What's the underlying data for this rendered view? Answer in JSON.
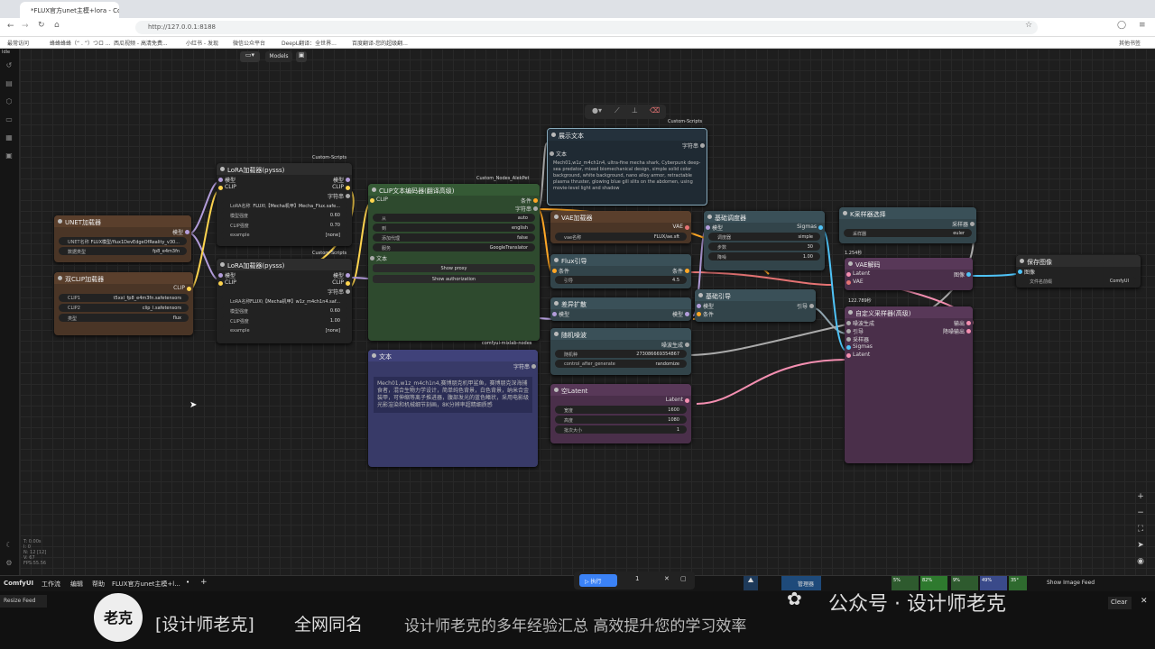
{
  "browser": {
    "tab_title": "*FLUX官方unet主模+lora - Co",
    "url": "http://127.0.0.1:8188",
    "bookmarks": [
      "最常访问",
      "蜂蜂蜂蜂（“ . ”）つロ ...",
      "西瓜视频 - 高清免费...",
      "小红书 - 发现",
      "微信公众平台",
      "DeepL翻译：全世界...",
      "百度翻译-您的超级翻..."
    ],
    "bookmarks_right": "其他书签"
  },
  "app": {
    "status_idle": "Idle",
    "models_label": "Models",
    "menu": [
      "ComfyUI",
      "工作流",
      "编辑",
      "帮助"
    ],
    "workflow_tab": "FLUX官方unet主模+l...",
    "queue_label": "执行",
    "queue_count": "1",
    "manager_label": "管理器",
    "show_image_feed": "Show Image Feed",
    "clear_label": "Clear",
    "resize_feed": "Resize Feed",
    "stats": {
      "cpu": "5%",
      "ram": "82%",
      "gpu": "9%",
      "vram": "49%",
      "temp": "35°"
    },
    "fps_lines": [
      "T: 0.00s",
      "I: 0",
      "N: 12 [12]",
      "V: 67",
      "FPS:55.56"
    ]
  },
  "nodes": {
    "unet": {
      "title": "UNET加载器",
      "out": "模型",
      "w": [
        [
          "UNET名称",
          "FLUX模型/flux1DevEdgeOfReality_v30..."
        ],
        [
          "数据类型",
          "fp8_e4m3fn"
        ]
      ]
    },
    "dualclip": {
      "title": "双CLIP加载器",
      "out": "CLIP",
      "w": [
        [
          "CLIP1",
          "t5xxl_fp8_e4m3fn.safetensors"
        ],
        [
          "CLIP2",
          "clip_l.safetensors"
        ],
        [
          "类型",
          "flux"
        ]
      ]
    },
    "lora1": {
      "title": "LoRA加载器(pysss)",
      "tag": "Custom-Scripts",
      "in": [
        "模型",
        "CLIP"
      ],
      "out": [
        "模型",
        "CLIP",
        "字符串"
      ],
      "w": [
        [
          "LoRA名称",
          "FLUX\\【Mecha机甲】Mecha_Flux.safe..."
        ],
        [
          "模型强度",
          "0.60"
        ],
        [
          "CLIP强度",
          "0.70"
        ],
        [
          "example",
          "[none]"
        ]
      ]
    },
    "lora2": {
      "title": "LoRA加载器(pysss)",
      "tag": "Custom-Scripts",
      "in": [
        "模型",
        "CLIP"
      ],
      "out": [
        "模型",
        "CLIP",
        "字符串"
      ],
      "w": [
        [
          "LoRA名称",
          "FLUX\\【Mecha机甲】w1z_m4ch1n4.saf..."
        ],
        [
          "模型强度",
          "0.60"
        ],
        [
          "CLIP强度",
          "1.00"
        ],
        [
          "example",
          "[none]"
        ]
      ]
    },
    "clipenc": {
      "title": "CLIP文本编码器(翻译高级)",
      "tag": "Custom_Nodes_AlekPet",
      "in": [
        "CLIP"
      ],
      "out": [
        "条件",
        "字符串"
      ],
      "w": [
        [
          "从",
          "auto"
        ],
        [
          "到",
          "english"
        ],
        [
          "添加代理",
          "false"
        ],
        [
          "服务",
          "GoogleTranslator"
        ]
      ],
      "text_label": "文本",
      "buttons": [
        "Show proxy",
        "Show authorization"
      ]
    },
    "textnode": {
      "title": "文本",
      "tag": "comfyui-mixlab-nodes",
      "out": "字符串",
      "text": "Mech01,w1z_m4ch1n4,赛博朋克机甲鲨鱼，赛博朋克深海捕食者，混合生物力学设计，简单纯色背景，白色背景，纳米合金装甲，可伸缩等离子推进器，腹部发光的蓝色鳍状，采用电影级光影渲染和机械细节刻画，8K分辨率超精细质感"
    },
    "showtext": {
      "title": "展示文本",
      "tag": "Custom-Scripts",
      "in": "文本",
      "out": "字符串",
      "text": "Mech01,w1z_m4ch1n4, ultra-fine mecha shark, Cyberpunk deep-sea predator, mixed biomechanical design, simple solid color background, white background, nano alloy armor, retractable plasma thruster, glowing blue gill slits on the abdomen, using movie-level light and shadow"
    },
    "vae": {
      "title": "VAE加载器",
      "out": "VAE",
      "w": [
        [
          "vae名称",
          "FLUX/ae.sft"
        ]
      ]
    },
    "fluxguide": {
      "title": "Flux引导",
      "in": "条件",
      "out": "条件",
      "w": [
        [
          "引导",
          "4.5"
        ]
      ]
    },
    "diffdiff": {
      "title": "差异扩散",
      "in": "模型",
      "out": "模型"
    },
    "noise": {
      "title": "随机噪波",
      "out": "噪波生成",
      "w": [
        [
          "随机种",
          "273086669354867"
        ],
        [
          "control_after_generate",
          "randomize"
        ]
      ]
    },
    "latent": {
      "title": "空Latent",
      "out": "Latent",
      "w": [
        [
          "宽度",
          "1600"
        ],
        [
          "高度",
          "1080"
        ],
        [
          "批次大小",
          "1"
        ]
      ]
    },
    "basicsched": {
      "title": "基础调度器",
      "in": "模型",
      "out": "Sigmas",
      "w": [
        [
          "调度器",
          "simple"
        ],
        [
          "步数",
          "30"
        ],
        [
          "降噪",
          "1.00"
        ]
      ]
    },
    "ksel": {
      "title": "K采样器选择",
      "out": "采样器",
      "w": [
        [
          "采样器",
          "euler"
        ]
      ]
    },
    "basicguide": {
      "title": "基础引导",
      "in": [
        "模型",
        "条件"
      ],
      "out": "引导"
    },
    "vaedec": {
      "title": "VAE解码",
      "time": "1.254秒",
      "in": [
        "Latent",
        "VAE"
      ],
      "out": "图像"
    },
    "custsampler": {
      "title": "自定义采样器(高级)",
      "time": "122.789秒",
      "in": [
        "噪波生成",
        "引导",
        "采样器",
        "Sigmas",
        "Latent"
      ],
      "out": [
        "输出",
        "降噪输出"
      ]
    },
    "save": {
      "title": "保存图像",
      "in": "图像",
      "w": [
        [
          "文件名前缀",
          "ComfyUI"
        ]
      ]
    }
  },
  "watermark": {
    "name": "[设计师老克]",
    "same": "全网同名",
    "slogan": "设计师老克的多年经验汇总  高效提升您的学习效率",
    "gzh": "公众号 · 设计师老克",
    "logo_text": "老克"
  }
}
